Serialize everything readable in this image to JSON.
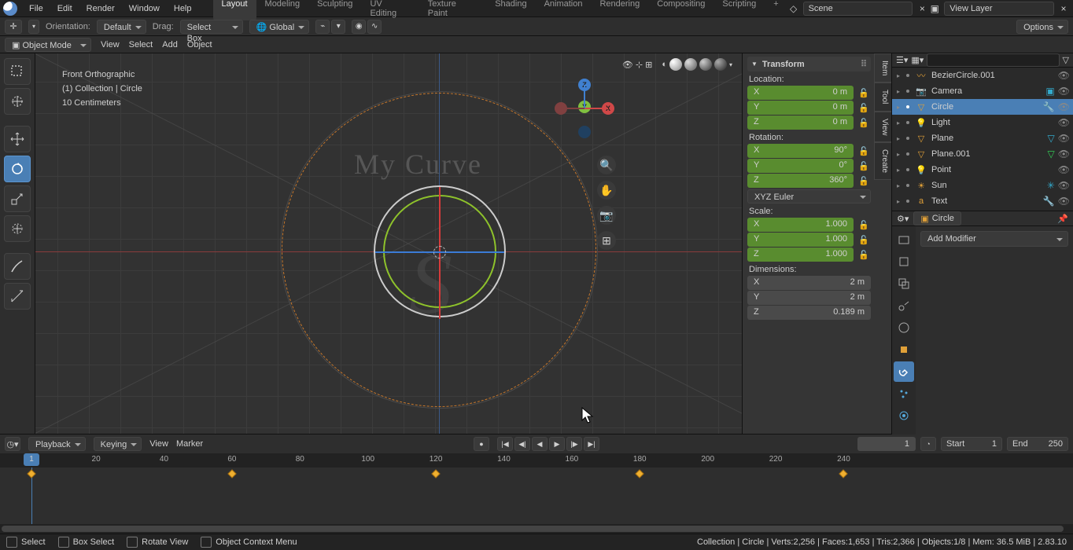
{
  "topbar": {
    "menus": [
      "File",
      "Edit",
      "Render",
      "Window",
      "Help"
    ],
    "tabs": [
      "Layout",
      "Modeling",
      "Sculpting",
      "UV Editing",
      "Texture Paint",
      "Shading",
      "Animation",
      "Rendering",
      "Compositing",
      "Scripting"
    ],
    "active_tab": "Layout",
    "scene_label": "Scene",
    "viewlayer_label": "View Layer"
  },
  "toolbar2": {
    "orientation_lbl": "Orientation:",
    "orientation_val": "Default",
    "drag_lbl": "Drag:",
    "drag_val": "Select Box",
    "transform_val": "Global",
    "options_lbl": "Options"
  },
  "toolbar3": {
    "mode": "Object Mode",
    "items": [
      "View",
      "Select",
      "Add",
      "Object"
    ]
  },
  "viewport": {
    "line1": "Front Orthographic",
    "line2": "(1) Collection | Circle",
    "line3": "10 Centimeters",
    "title_text": "My Curve",
    "glyph": "S"
  },
  "npanel": {
    "title": "Transform",
    "loc_lbl": "Location:",
    "loc": {
      "x": "0 m",
      "y": "0 m",
      "z": "0 m"
    },
    "rot_lbl": "Rotation:",
    "rot": {
      "x": "90°",
      "y": "0°",
      "z": "360°"
    },
    "rot_mode": "XYZ Euler",
    "scale_lbl": "Scale:",
    "scale": {
      "x": "1.000",
      "y": "1.000",
      "z": "1.000"
    },
    "dim_lbl": "Dimensions:",
    "dim": {
      "x": "2 m",
      "y": "2 m",
      "z": "0.189 m"
    },
    "tabs": [
      "Item",
      "Tool",
      "View",
      "Create"
    ]
  },
  "outliner": {
    "filter_placeholder": "",
    "items": [
      {
        "name": "BezierCircle.001",
        "color": "#e0a038",
        "type": "curve"
      },
      {
        "name": "Camera",
        "color": "#e0a038",
        "type": "camera",
        "hl": true
      },
      {
        "name": "Circle",
        "color": "#e0a038",
        "type": "mesh",
        "sel": true
      },
      {
        "name": "Light",
        "color": "#e0a038",
        "type": "light"
      },
      {
        "name": "Plane",
        "color": "#e0a038",
        "type": "mesh"
      },
      {
        "name": "Plane.001",
        "color": "#e0a038",
        "type": "mesh",
        "hl2": true
      },
      {
        "name": "Point",
        "color": "#e0a038",
        "type": "light"
      },
      {
        "name": "Sun",
        "color": "#e0a038",
        "type": "light",
        "hl3": true
      },
      {
        "name": "Text",
        "color": "#e0a038",
        "type": "text",
        "hl4": true
      }
    ]
  },
  "props": {
    "crumb": "Circle",
    "add_mod": "Add Modifier"
  },
  "timeline": {
    "menus": [
      "Playback",
      "Keying",
      "View",
      "Marker"
    ],
    "current": "1",
    "start_lbl": "Start",
    "start_val": "1",
    "end_lbl": "End",
    "end_val": "250",
    "ticks": [
      1,
      20,
      40,
      60,
      80,
      100,
      120,
      140,
      160,
      180,
      200,
      220,
      240
    ],
    "keys_at": [
      1,
      60,
      120,
      180,
      240
    ]
  },
  "status": {
    "select": "Select",
    "box": "Box Select",
    "rotate": "Rotate View",
    "ctx": "Object Context Menu",
    "right": "Collection | Circle | Verts:2,256 | Faces:1,653 | Tris:2,366 | Objects:1/8 | Mem: 36.5 MiB | 2.83.10"
  }
}
